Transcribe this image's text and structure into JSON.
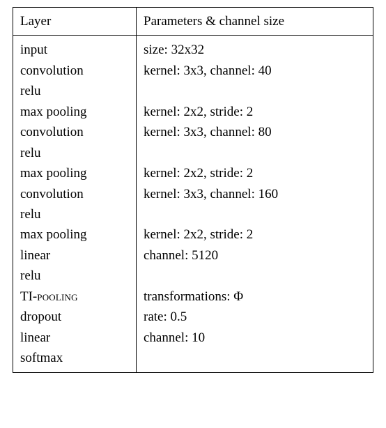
{
  "chart_data": {
    "type": "table",
    "headers": [
      "Layer",
      "Parameters & channel size"
    ],
    "rows": [
      {
        "layer": "input",
        "params": "size: 32x32"
      },
      {
        "layer": "convolution",
        "params": "kernel: 3x3, channel: 40"
      },
      {
        "layer": "relu",
        "params": ""
      },
      {
        "layer": "max pooling",
        "params": "kernel: 2x2, stride: 2"
      },
      {
        "layer": "convolution",
        "params": "kernel: 3x3, channel: 80"
      },
      {
        "layer": "relu",
        "params": ""
      },
      {
        "layer": "max pooling",
        "params": "kernel: 2x2, stride: 2"
      },
      {
        "layer": "convolution",
        "params": "kernel: 3x3, channel: 160"
      },
      {
        "layer": "relu",
        "params": ""
      },
      {
        "layer": "max pooling",
        "params": "kernel: 2x2, stride: 2"
      },
      {
        "layer": "linear",
        "params": "channel: 5120"
      },
      {
        "layer": "relu",
        "params": ""
      },
      {
        "layer": "TI-POOLING",
        "params": "transformations: Φ",
        "special": "ti"
      },
      {
        "layer": "dropout",
        "params": "rate: 0.5"
      },
      {
        "layer": "linear",
        "params": "channel: 10"
      },
      {
        "layer": "softmax",
        "params": ""
      }
    ]
  }
}
